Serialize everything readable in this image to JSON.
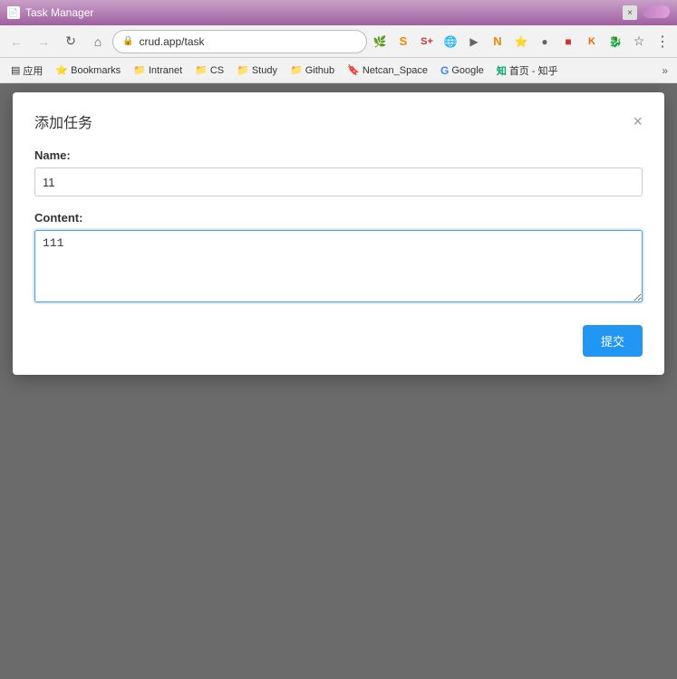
{
  "browser": {
    "title": "Task Manager",
    "url": "crud.app/task",
    "url_full": "crud.app/task",
    "protocol_icon": "🔒"
  },
  "titlebar": {
    "title": "Task Manager",
    "close_label": "×"
  },
  "bookmarks": {
    "label": "应用",
    "items": [
      {
        "label": "Bookmarks",
        "icon": "⭐"
      },
      {
        "label": "Intranet",
        "icon": "📁"
      },
      {
        "label": "CS",
        "icon": "📁"
      },
      {
        "label": "Study",
        "icon": "📁"
      },
      {
        "label": "Github",
        "icon": "📁"
      },
      {
        "label": "Netcan_Space",
        "icon": "🔖"
      },
      {
        "label": "Google",
        "icon": "G"
      },
      {
        "label": "首页 - 知乎",
        "icon": "知"
      },
      {
        "label": "»",
        "icon": ""
      }
    ]
  },
  "modal": {
    "title": "添加任务",
    "close_label": "×",
    "name_label": "Name:",
    "name_value": "11",
    "content_label": "Content:",
    "content_value": "111",
    "submit_label": "提交"
  },
  "colors": {
    "accent": "#2196f3",
    "nav_bg": "#f2f2f2",
    "page_bg": "#6b6b6b"
  }
}
